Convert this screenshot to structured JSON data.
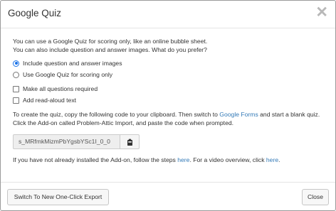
{
  "dialog": {
    "title": "Google Quiz",
    "close_symbol": "✕"
  },
  "intro": {
    "line1": "You can use a Google Quiz for scoring only, like an online bubble sheet.",
    "line2": "You can also include question and answer images. What do you prefer?"
  },
  "options": {
    "radio_include": "Include question and answer images",
    "radio_scoring": "Use Google Quiz for scoring only",
    "checkbox_required": "Make all questions required",
    "checkbox_readaloud": "Add read-aloud text",
    "selected_radio": "radio_include"
  },
  "instructions": {
    "part1": "To create the quiz, copy the following code to your clipboard. Then switch to ",
    "link": "Google Forms",
    "part2": " and start a blank quiz.",
    "line2": "Click the Add-on called Problem-Attic Import, and paste the code when prompted."
  },
  "code": {
    "value": "s_MRfmkMizmPbYgsbYSc1I_0_0",
    "copy_icon": "clipboard-icon"
  },
  "addon_note": {
    "part1": "If you have not already installed the Add-on, follow the steps ",
    "link1": "here",
    "part2": ". For a video overview, click ",
    "link2": "here",
    "part3": "."
  },
  "footer": {
    "switch_label": "Switch To New One-Click Export",
    "close_label": "Close"
  },
  "colors": {
    "link": "#337ab7",
    "accent": "#1a73e8"
  }
}
